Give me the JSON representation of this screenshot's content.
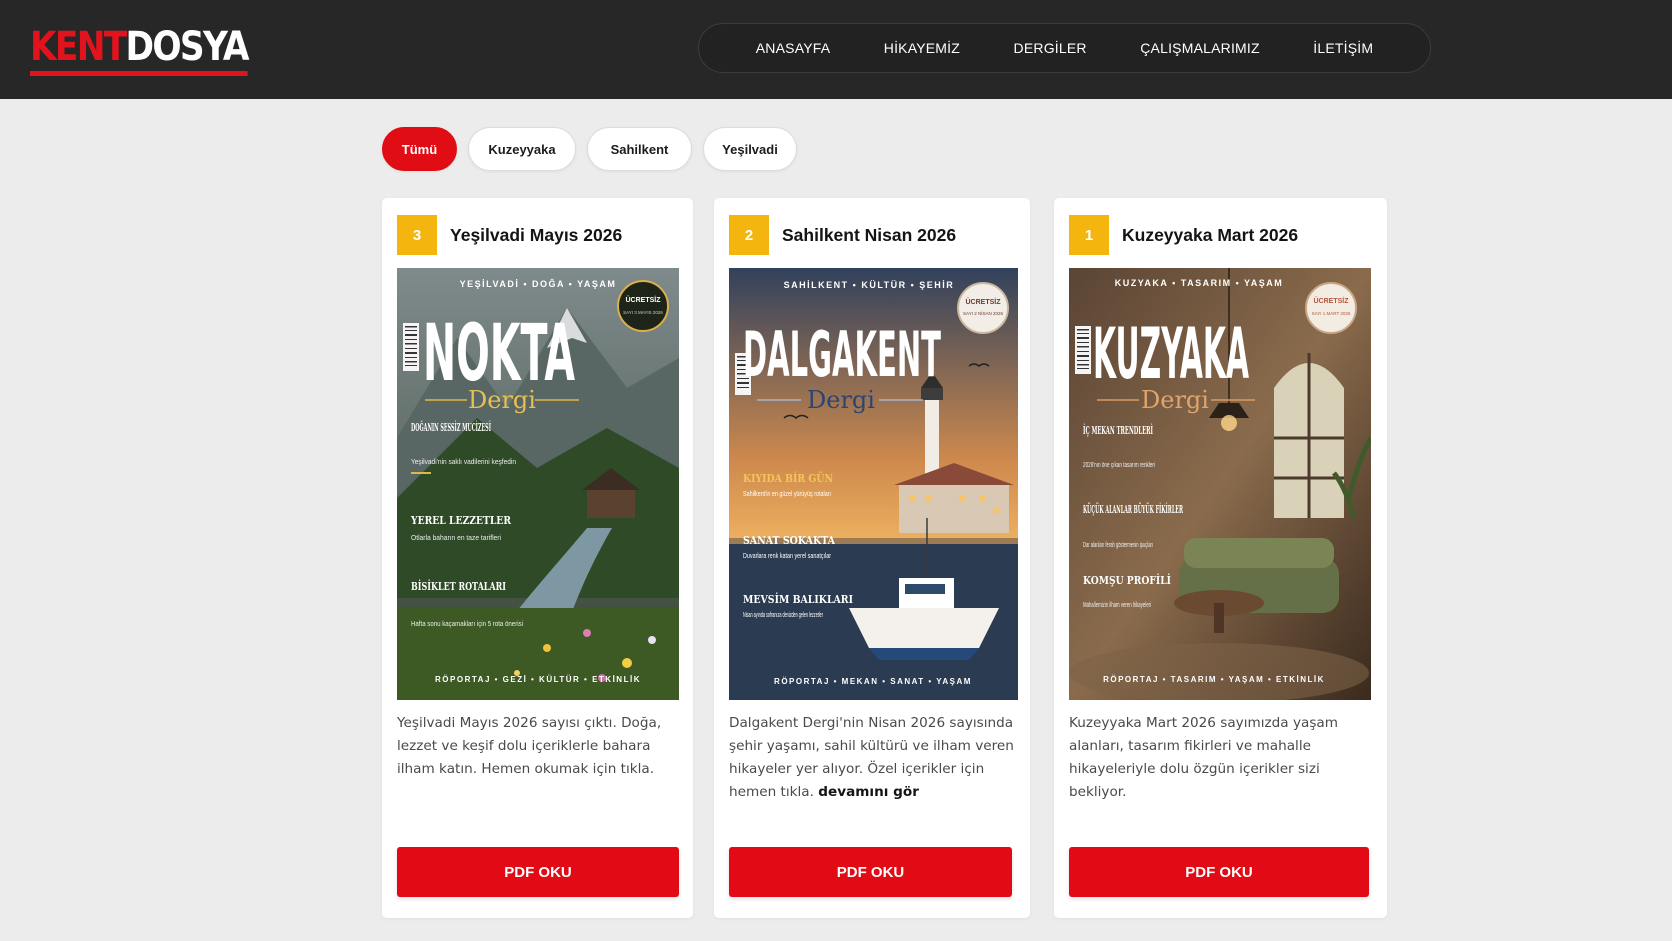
{
  "brand": {
    "part1": "KENT",
    "part2": "DOSYA"
  },
  "nav": [
    "ANASAYFA",
    "HİKAYEMİZ",
    "DERGİLER",
    "ÇALIŞMALARIMIZ",
    "İLETİŞİM"
  ],
  "filters": [
    {
      "label": "Tümü",
      "active": true
    },
    {
      "label": "Kuzeyyaka",
      "active": false
    },
    {
      "label": "Sahilkent",
      "active": false
    },
    {
      "label": "Yeşilvadi",
      "active": false
    }
  ],
  "cards": [
    {
      "number": "3",
      "title": "Yeşilvadi Mayıs 2026",
      "description": "Yeşilvadi Mayıs 2026 sayısı çıktı. Doğa, lezzet ve keşif dolu içeriklerle bahara ilham katın. Hemen okumak için tıkla.",
      "more": "",
      "button": "PDF OKU",
      "cover": {
        "tagline": "YEŞİLVADİ • DOĞA • YAŞAM",
        "masthead": "NOKTA",
        "sub": "Dergi",
        "seal": "ÜCRETSİZ",
        "seal_small": "SAYI 3 MAYIS 2026",
        "headlines": [
          {
            "title": "DOĞANIN SESSİZ MUCİZESİ",
            "text": "Yeşilvadi'nin saklı vadilerini keşfedin"
          },
          {
            "title": "YEREL LEZZETLER",
            "text": "Otlarla baharın en taze tarifleri"
          },
          {
            "title": "BİSİKLET ROTALARI",
            "text": "Hafta sonu kaçamakları için 5 rota önerisi"
          }
        ],
        "footer": "RÖPORTAJ • GEZİ • KÜLTÜR • ETKİNLİK"
      }
    },
    {
      "number": "2",
      "title": "Sahilkent Nisan 2026",
      "description": "Dalgakent Dergi'nin Nisan 2026 sayısında şehir yaşamı, sahil kültürü ve ilham veren hikayeler yer alıyor. Özel içerikler için hemen tıkla.",
      "more": "devamını gör",
      "button": "PDF OKU",
      "cover": {
        "tagline": "SAHİLKENT • KÜLTÜR • ŞEHİR",
        "masthead": "DALGAKENT",
        "sub": "Dergi",
        "seal": "ÜCRETSİZ",
        "seal_small": "SAYI 2 NİSAN 2026",
        "headlines": [
          {
            "title": "KIYIDA BİR GÜN",
            "text": "Sahilkent'in en güzel yürüyüş rotaları"
          },
          {
            "title": "SANAT SOKAKTA",
            "text": "Duvarlara renk katan yerel sanatçılar"
          },
          {
            "title": "MEVSİM BALIKLARI",
            "text": "Nisan ayında sofranıza denizden gelen lezzetler"
          }
        ],
        "footer": "RÖPORTAJ • MEKAN • SANAT • YAŞAM"
      }
    },
    {
      "number": "1",
      "title": "Kuzeyyaka Mart 2026",
      "description": "Kuzeyyaka Mart 2026 sayımızda yaşam alanları, tasarım fikirleri ve mahalle hikayeleriyle dolu özgün içerikler sizi bekliyor.",
      "more": "",
      "button": "PDF OKU",
      "cover": {
        "tagline": "KUZYAKA • TASARIM • YAŞAM",
        "masthead": "KUZYAKA",
        "sub": "Dergi",
        "seal": "ÜCRETSİZ",
        "seal_small": "SAYI 1 MART 2026",
        "headlines": [
          {
            "title": "İÇ MEKAN TRENDLERİ",
            "text": "2026'nın öne çıkan tasarım renkleri"
          },
          {
            "title": "KÜÇÜK ALANLAR BÜYÜK FİKİRLER",
            "text": "Dar alanları ferah göstermenin ipuçları"
          },
          {
            "title": "KOMŞU PROFİLİ",
            "text": "Mahallemizin ilham veren hikayeleri"
          }
        ],
        "footer": "RÖPORTAJ • TASARIM • YAŞAM • ETKİNLİK"
      }
    }
  ],
  "colors": {
    "accent": "#e20a14",
    "badge": "#f5b50f",
    "header": "#272727"
  }
}
